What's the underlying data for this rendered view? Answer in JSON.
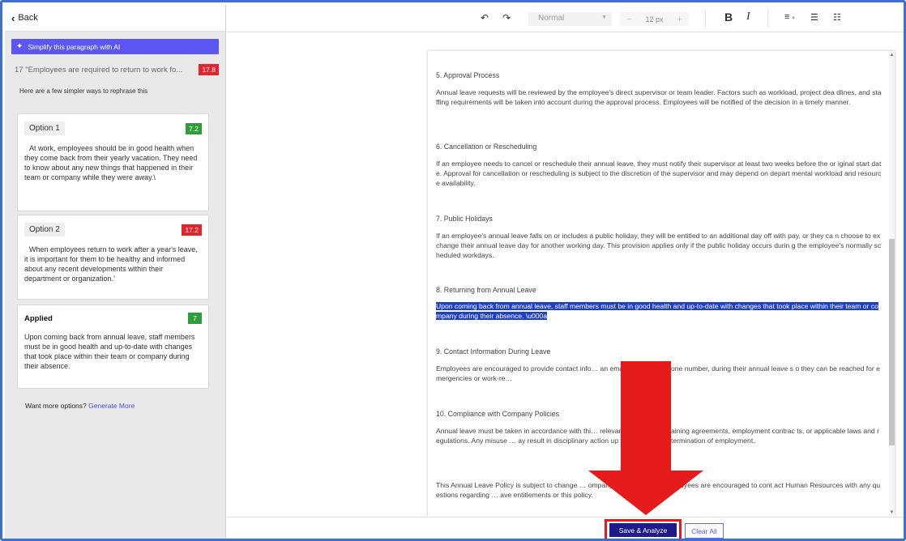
{
  "sidebar": {
    "back_label": "Back",
    "ai_banner": "Simplify this paragraph with AI",
    "original_snippet": "17 \"Employees are required to return to work fo...",
    "original_score": "17.8",
    "helper_text": "Here are a few simpler ways to rephrase this",
    "options": [
      {
        "label": "Option 1",
        "score": "7.2",
        "score_color": "#2e9d3a",
        "text": "At work, employees should be in good health when they come back from their yearly vacation. They need to know about any new things that happened in their team or company while they were away.\\"
      },
      {
        "label": "Option 2",
        "score": "17.2",
        "score_color": "#e4232b",
        "text": "When employees return to work after a year's leave, it is important for them to be healthy and informed about any recent developments within their department or organization.'"
      }
    ],
    "applied": {
      "label": "Applied",
      "score": "7",
      "text": "Upon coming back from annual leave, staff members must be in good health and up-to-date with changes that took place within their team or company during their absence."
    },
    "more_options": "Want more options?",
    "generate_more": "Generate More"
  },
  "toolbar": {
    "undo_icon": "undo-icon",
    "redo_icon": "redo-icon",
    "style_value": "Normal",
    "font_size": "12",
    "font_unit": "px",
    "bold": "B",
    "italic": "I"
  },
  "document": {
    "sections": [
      {
        "heading": "5. Approval Process",
        "body": "Annual leave requests will be reviewed by the employee's direct supervisor or team leader. Factors such as workload, project dea dlines, and staffing requirements will be taken into account during the approval process. Employees will be notified of the decision in a timely manner."
      },
      {
        "heading": "6. Cancellation or Rescheduling",
        "body": "If an employee needs to cancel or reschedule their annual leave, they must notify their supervisor at least two weeks before the or iginal start date. Approval for cancellation or rescheduling is subject to the discretion of the supervisor and may depend on depart mental workload and resource availability."
      },
      {
        "heading": "7. Public Holidays",
        "body": "If an employee's annual leave falls on or includes a public holiday, they will be entitled to an additional day off with pay, or they ca n choose to exchange their annual leave day for another working day. This provision applies only if the public holiday occurs durin g the employee's normally scheduled workdays."
      },
      {
        "heading": "8. Returning from Annual Leave",
        "body": "Upon coming back from annual leave, staff members must be in good health and up-to-date with changes that took place within their team or company during their absence. \\u000a"
      },
      {
        "heading": "9. Contact Information During Leave",
        "body": "Employees are encouraged to provide contact info… an email address or phone number, during their annual leave s o they can be reached for emergencies or work-re…"
      },
      {
        "heading": "10. Compliance with Company Policies",
        "body": "Annual leave must be taken in accordance with thi… relevant collective bargaining agreements, employment contrac ts, or applicable laws and regulations. Any misuse … ay result in disciplinary action up to and including termination of employment."
      },
      {
        "heading": "",
        "body": "This Annual Leave Policy is subject to change … ompany's management. Employees are encouraged to cont act Human Resources with any questions regarding … ave entitlements or this policy."
      }
    ]
  },
  "footer": {
    "save_label": "Save & Analyze",
    "clear_label": "Clear All"
  },
  "colors": {
    "accent": "#5b57f0",
    "save_button": "#1e1a8c",
    "highlight": "#1f3fc6",
    "annotation": "#e51b1b"
  }
}
